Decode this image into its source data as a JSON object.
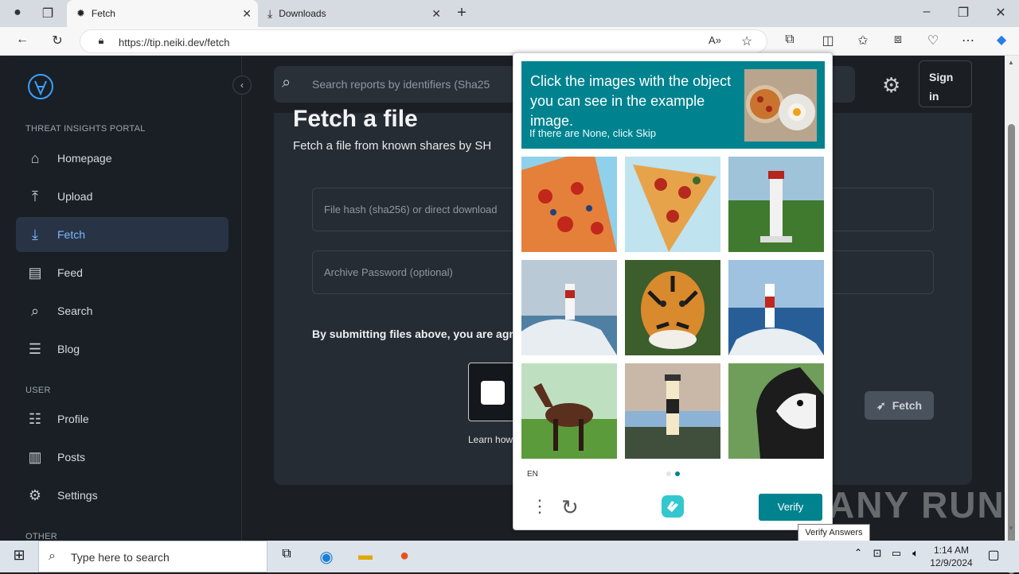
{
  "browser": {
    "tabs": [
      {
        "label": "Fetch",
        "active": true
      },
      {
        "label": "Downloads",
        "active": false
      }
    ],
    "url": "https://tip.neiki.dev/fetch"
  },
  "sidebar": {
    "section_main": "THREAT INSIGHTS PORTAL",
    "items": [
      {
        "label": "Homepage",
        "icon": "home-icon"
      },
      {
        "label": "Upload",
        "icon": "upload-icon"
      },
      {
        "label": "Fetch",
        "icon": "fetch-icon",
        "active": true
      },
      {
        "label": "Feed",
        "icon": "feed-icon"
      },
      {
        "label": "Search",
        "icon": "search-icon"
      },
      {
        "label": "Blog",
        "icon": "blog-icon"
      }
    ],
    "section_user": "USER",
    "user_items": [
      {
        "label": "Profile",
        "icon": "profile-icon"
      },
      {
        "label": "Posts",
        "icon": "posts-icon"
      },
      {
        "label": "Settings",
        "icon": "settings-icon"
      }
    ],
    "section_other": "OTHER"
  },
  "topbar": {
    "search_placeholder": "Search reports by identifiers (Sha25",
    "signin_label": "Sign in"
  },
  "main": {
    "title": "Fetch a file",
    "subtitle": "Fetch a file from known shares by SH",
    "hash_placeholder": "File hash (sha256) or direct download",
    "password_placeholder": "Archive Password (optional)",
    "terms_text": "By submitting files above, you are agre",
    "learn_how": "Learn how",
    "fetch_button": "Fetch"
  },
  "captcha": {
    "prompt": "Click the images with the object you can see in the example image.",
    "hint": "If there are None, click Skip",
    "language": "EN",
    "verify_label": "Verify",
    "tooltip": "Verify Answers",
    "tiles": [
      "pizza",
      "pizza",
      "lighthouse",
      "lighthouse",
      "tiger",
      "lighthouse",
      "horse",
      "lighthouse",
      "horse"
    ]
  },
  "watermark": "ANY RUN",
  "taskbar": {
    "search_placeholder": "Type here to search",
    "time": "1:14 AM",
    "date": "12/9/2024"
  },
  "colors": {
    "captcha_teal": "#00838f",
    "active_nav": "#283445",
    "active_nav_text": "#7fb7ff"
  }
}
